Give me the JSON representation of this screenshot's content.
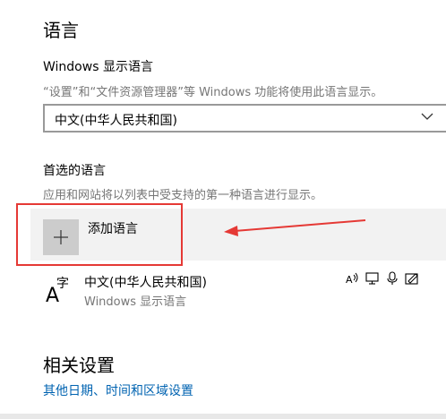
{
  "language_section": {
    "title": "语言",
    "display_language": {
      "label": "Windows 显示语言",
      "description": "“设置”和“文件资源管理器”等 Windows 功能将使用此语言显示。",
      "selected_value": "中文(中华人民共和国)"
    },
    "preferred_languages": {
      "label": "首选的语言",
      "description": "应用和网站将以列表中受支持的第一种语言进行显示。",
      "add_label": "添加语言",
      "items": [
        {
          "name": "中文(中华人民共和国)",
          "subtitle": "Windows 显示语言",
          "icon": "language-glyph-icon",
          "feature_icons": [
            "text-to-speech-icon",
            "display-language-icon",
            "speech-recognition-icon",
            "handwriting-icon"
          ]
        }
      ]
    }
  },
  "related_settings": {
    "title": "相关设置",
    "link": "其他日期、时间和区域设置"
  },
  "annotation": {
    "highlight_color": "#e53935"
  },
  "colors": {
    "accent_link": "#0063b1",
    "secondary_text": "#767676",
    "add_row_bg": "#f2f2f2",
    "plus_bg": "#cccccc"
  }
}
